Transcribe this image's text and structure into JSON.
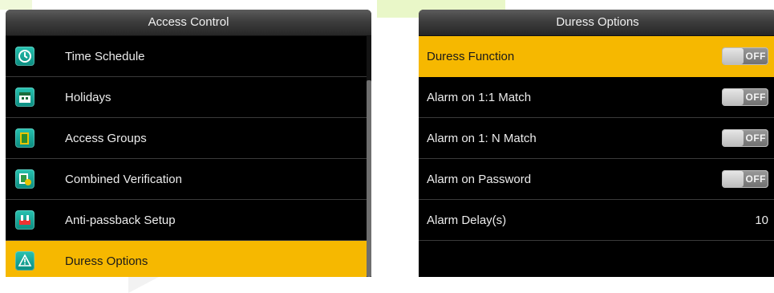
{
  "left_panel": {
    "title": "Access Control",
    "items": [
      {
        "label": "Time Schedule",
        "icon": "clock-icon",
        "selected": false
      },
      {
        "label": "Holidays",
        "icon": "calendar-icon",
        "selected": false
      },
      {
        "label": "Access Groups",
        "icon": "door-group-icon",
        "selected": false
      },
      {
        "label": "Combined Verification",
        "icon": "combined-verification-icon",
        "selected": false
      },
      {
        "label": "Anti-passback Setup",
        "icon": "anti-passback-icon",
        "selected": false
      },
      {
        "label": "Duress Options",
        "icon": "duress-warning-icon",
        "selected": true
      }
    ]
  },
  "right_panel": {
    "title": "Duress Options",
    "options": [
      {
        "label": "Duress Function",
        "toggle": "OFF",
        "selected": true
      },
      {
        "label": "Alarm on 1:1 Match",
        "toggle": "OFF",
        "selected": false
      },
      {
        "label": "Alarm on 1: N Match",
        "toggle": "OFF",
        "selected": false
      },
      {
        "label": "Alarm on Password",
        "toggle": "OFF",
        "selected": false
      }
    ],
    "alarm_delay": {
      "label": "Alarm Delay(s)",
      "value": "10"
    }
  },
  "colors": {
    "selected": "#f6b800",
    "panel": "#000000",
    "icon": "#14a898"
  }
}
